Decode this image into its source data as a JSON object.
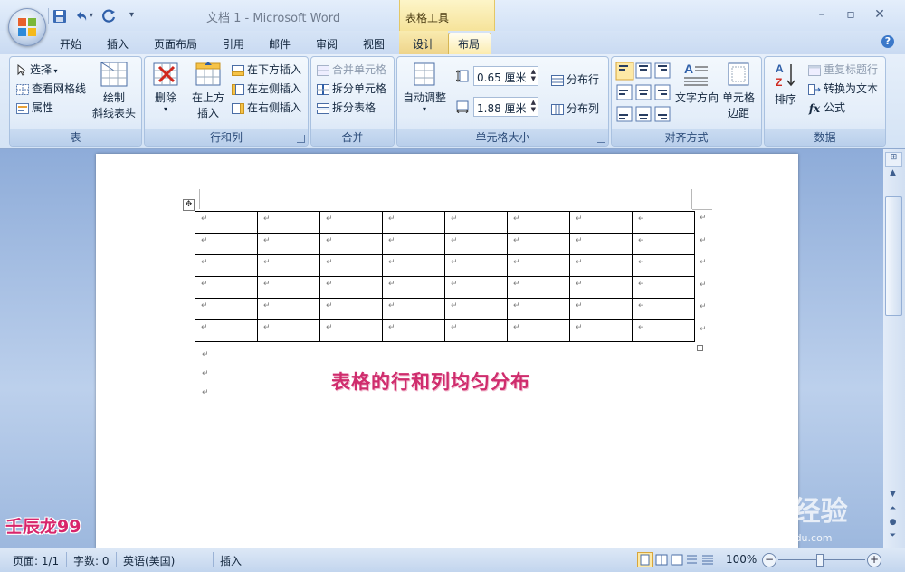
{
  "window": {
    "doc_title": "文档 1 - Microsoft Word",
    "contextual_group": "表格工具"
  },
  "tabs": [
    "开始",
    "插入",
    "页面布局",
    "引用",
    "邮件",
    "审阅",
    "视图",
    "设计",
    "布局"
  ],
  "active_tab": "布局",
  "ribbon": {
    "table": {
      "label": "表",
      "select": "选择",
      "view_gridlines": "查看网格线",
      "properties": "属性",
      "draw_diag_line1": "绘制",
      "draw_diag_line2": "斜线表头"
    },
    "rows_cols": {
      "label": "行和列",
      "delete": "删除",
      "insert_above_line1": "在上方",
      "insert_above_line2": "插入",
      "insert_below": "在下方插入",
      "insert_left": "在左侧插入",
      "insert_right": "在右侧插入"
    },
    "merge": {
      "label": "合并",
      "merge_cells": "合并单元格",
      "split_cells": "拆分单元格",
      "split_table": "拆分表格"
    },
    "cell_size": {
      "label": "单元格大小",
      "autofit": "自动调整",
      "height": "0.65 厘米",
      "width": "1.88 厘米",
      "distribute_rows": "分布行",
      "distribute_cols": "分布列"
    },
    "alignment": {
      "label": "对齐方式",
      "text_direction": "文字方向",
      "cell_margins_line1": "单元格",
      "cell_margins_line2": "边距"
    },
    "data": {
      "label": "数据",
      "sort": "排序",
      "repeat_header": "重复标题行",
      "convert_to_text": "转换为文本",
      "formula": "公式"
    }
  },
  "document": {
    "table_rows": 6,
    "table_cols": 8,
    "caption": "表格的行和列均匀分布"
  },
  "watermarks": {
    "author": "壬辰龙99",
    "site": "Baidu 经验",
    "url": "jingyan.baidu.com"
  },
  "status": {
    "page": "页面: 1/1",
    "words": "字数: 0",
    "language": "英语(美国)",
    "mode": "插入",
    "zoom": "100%"
  },
  "colors": {
    "ribbon_blue": "#d4e3f5",
    "contextual_yellow": "#f6e39a",
    "caption_pink": "#cf2c6d"
  }
}
